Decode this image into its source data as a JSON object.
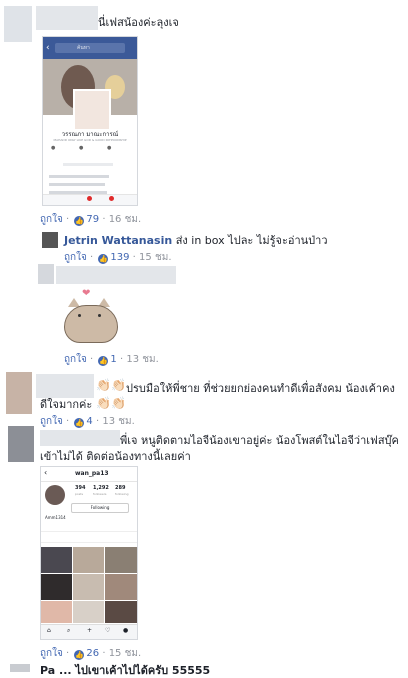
{
  "comments": [
    {
      "id": "c1",
      "text": "นี่เฟสน้องค่ะลุงเจ",
      "like_label": "ถูกใจ",
      "like_count": "79",
      "time": "16 ชม.",
      "screenshot": {
        "profile_name": "วรรณภา มาณะการณ์",
        "tagline": "MAHADD ONLY LIKE GOD & GOOD PATPOONSHIP",
        "search_placeholder": "ค้นหา"
      }
    },
    {
      "id": "r1",
      "name": "Jetrin Wattanasin",
      "text": "ส่ง in box ไปละ ไม่รู้จะอ่านป่าว",
      "like_label": "ถูกใจ",
      "like_count": "139",
      "time": "15 ชม."
    },
    {
      "id": "r2",
      "like_label": "ถูกใจ",
      "like_count": "1",
      "time": "13 ชม."
    },
    {
      "id": "c2",
      "text_line1": "ปรบมือให้พี่ชาย ที่ช่วยยกย่องคนทำดีเพื่อสังคม น้องเค้าคง",
      "text_line2": "ดีใจมากค่ะ",
      "like_label": "ถูกใจ",
      "like_count": "4",
      "time": "13 ชม."
    },
    {
      "id": "c3",
      "text_line1": "พี่เจ หนูติดตามไอจีน้องเขาอยู่ค่ะ น้องโพสต์ในไอจีว่าเฟสบุ๊ค",
      "text_line2": "เข้าไม่ได้ ติดต่อน้องทางนี้เลยค่า",
      "like_label": "ถูกใจ",
      "like_count": "26",
      "time": "15 ชม.",
      "instagram": {
        "username": "wan_pa13",
        "posts": "394",
        "followers": "1,292",
        "following": "289",
        "posts_label": "posts",
        "followers_label": "followers",
        "following_label": "following",
        "follow_button": "Following",
        "bio_name": "Amm1314"
      }
    }
  ],
  "truncated_next": "Pa ... ไปเขาเค้าไปได้ครับ 55555",
  "colors": {
    "link": "#365899",
    "like_blue": "#4267b2",
    "meta_gray": "#90949c"
  }
}
